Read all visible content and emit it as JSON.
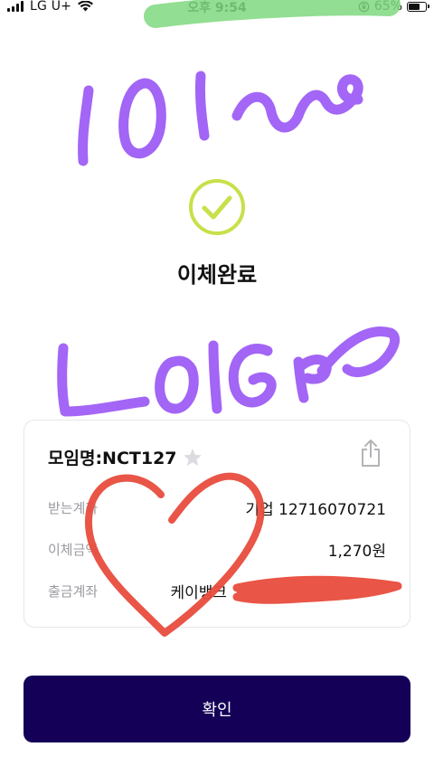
{
  "status_bar": {
    "carrier": "LG U+",
    "time": "오후 9:54",
    "battery_percent": "65%",
    "battery_level": 0.65
  },
  "result": {
    "title": "이체완료",
    "icon": "check-circle-icon",
    "accent_color": "#c8e04a"
  },
  "card": {
    "meeting_name": "모임명:NCT127",
    "rows": [
      {
        "label": "받는계좌",
        "value": "기업 12716070721"
      },
      {
        "label": "이체금액",
        "value": "1,270원"
      },
      {
        "label": "출금계좌",
        "value": "케이뱅크"
      }
    ]
  },
  "footer": {
    "confirm_label": "확인",
    "button_color": "#140057"
  },
  "annotations": {
    "marker_color": "#9b59f5",
    "heart_color": "#e84c3d",
    "highlight_color": "#7fd87f"
  }
}
